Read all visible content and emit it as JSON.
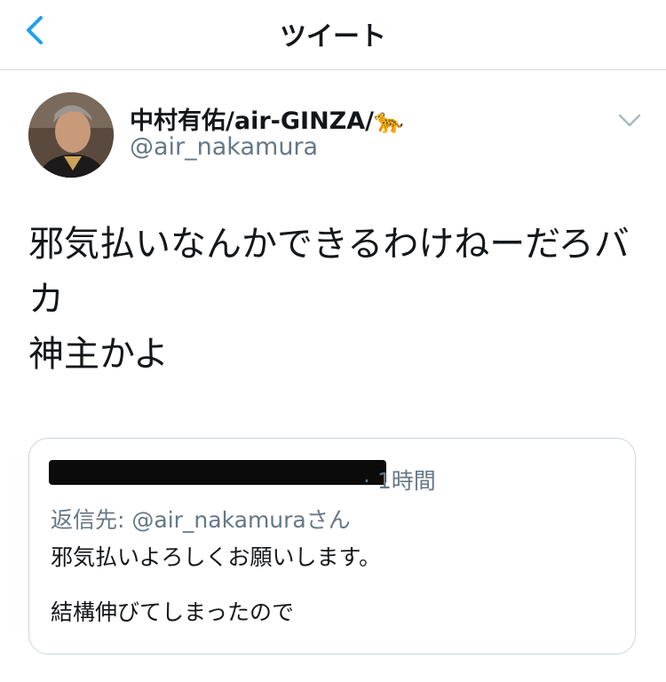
{
  "nav": {
    "title": "ツイート"
  },
  "author": {
    "name": "中村有佑/air-GINZA/🐆",
    "handle": "@air_nakamura"
  },
  "tweet": {
    "text": "邪気払いなんかできるわけねーだろバ\nカ\n神主かよ"
  },
  "quoted": {
    "time": "· 1時間",
    "reply_prefix": "返信先: ",
    "reply_mention": "@air_nakamura",
    "reply_suffix": "さん",
    "text": "邪気払いよろしくお願いします。\n\n結構伸びてしまったので"
  },
  "colors": {
    "link": "#1da1f2",
    "secondary": "#657786",
    "border": "#ccd6dd"
  },
  "icons": {
    "back": "chevron-left-icon",
    "more": "chevron-down-icon"
  }
}
